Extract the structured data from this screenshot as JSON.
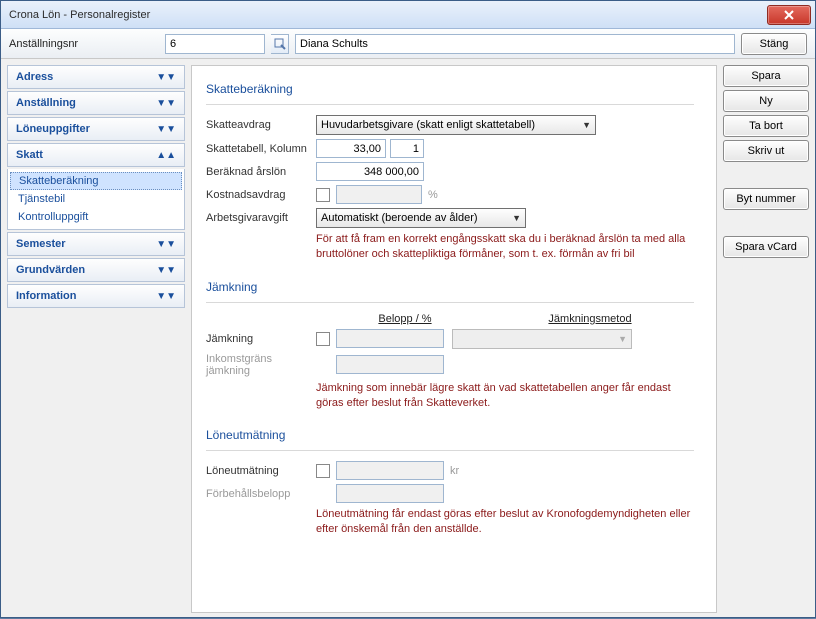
{
  "window": {
    "title": "Crona Lön - Personalregister"
  },
  "toolbar": {
    "label": "Anställningsnr",
    "number_value": "6",
    "name_value": "Diana Schults",
    "close_label": "Stäng"
  },
  "nav": {
    "adress": "Adress",
    "anstallning": "Anställning",
    "loneuppgifter": "Löneuppgifter",
    "skatt": "Skatt",
    "skatt_items": {
      "skatteberakning": "Skatteberäkning",
      "tjanstebil": "Tjänstebil",
      "kontrolluppgift": "Kontrolluppgift"
    },
    "semester": "Semester",
    "grundvarden": "Grundvärden",
    "information": "Information"
  },
  "buttons": {
    "spara": "Spara",
    "ny": "Ny",
    "tabort": "Ta bort",
    "skrivut": "Skriv ut",
    "bytnummer": "Byt nummer",
    "sparavcard": "Spara vCard"
  },
  "sections": {
    "skatteberakning": {
      "title": "Skatteberäkning",
      "skatteavdrag_label": "Skatteavdrag",
      "skatteavdrag_value": "Huvudarbetsgivare (skatt enligt skattetabell)",
      "skattetabell_label": "Skattetabell, Kolumn",
      "skattetabell_value": "33,00",
      "kolumn_value": "1",
      "beraknad_label": "Beräknad årslön",
      "beraknad_value": "348 000,00",
      "kostnad_label": "Kostnadsavdrag",
      "kostnad_value": "",
      "kostnad_suffix": "%",
      "arbetsgivar_label": "Arbetsgivaravgift",
      "arbetsgivar_value": "Automatiskt (beroende av ålder)",
      "note": "För att få fram en korrekt engångsskatt ska du i beräknad årslön ta med alla bruttolöner och skattepliktiga förmåner, som t. ex. förmån av fri bil"
    },
    "jamkning": {
      "title": "Jämkning",
      "col_bp": "Belopp / %",
      "col_method": "Jämkningsmetod",
      "jamkning_label": "Jämkning",
      "inkomst_label": "Inkomstgräns jämkning",
      "note": "Jämkning som innebär lägre skatt än vad skattetabellen anger får endast göras efter beslut från Skatteverket."
    },
    "loneutmatning": {
      "title": "Löneutmätning",
      "loneutmatning_label": "Löneutmätning",
      "kr_suffix": "kr",
      "forbehall_label": "Förbehållsbelopp",
      "note": "Löneutmätning får endast göras efter beslut av Kronofogdemyndigheten eller efter önskemål från den anställde."
    }
  }
}
